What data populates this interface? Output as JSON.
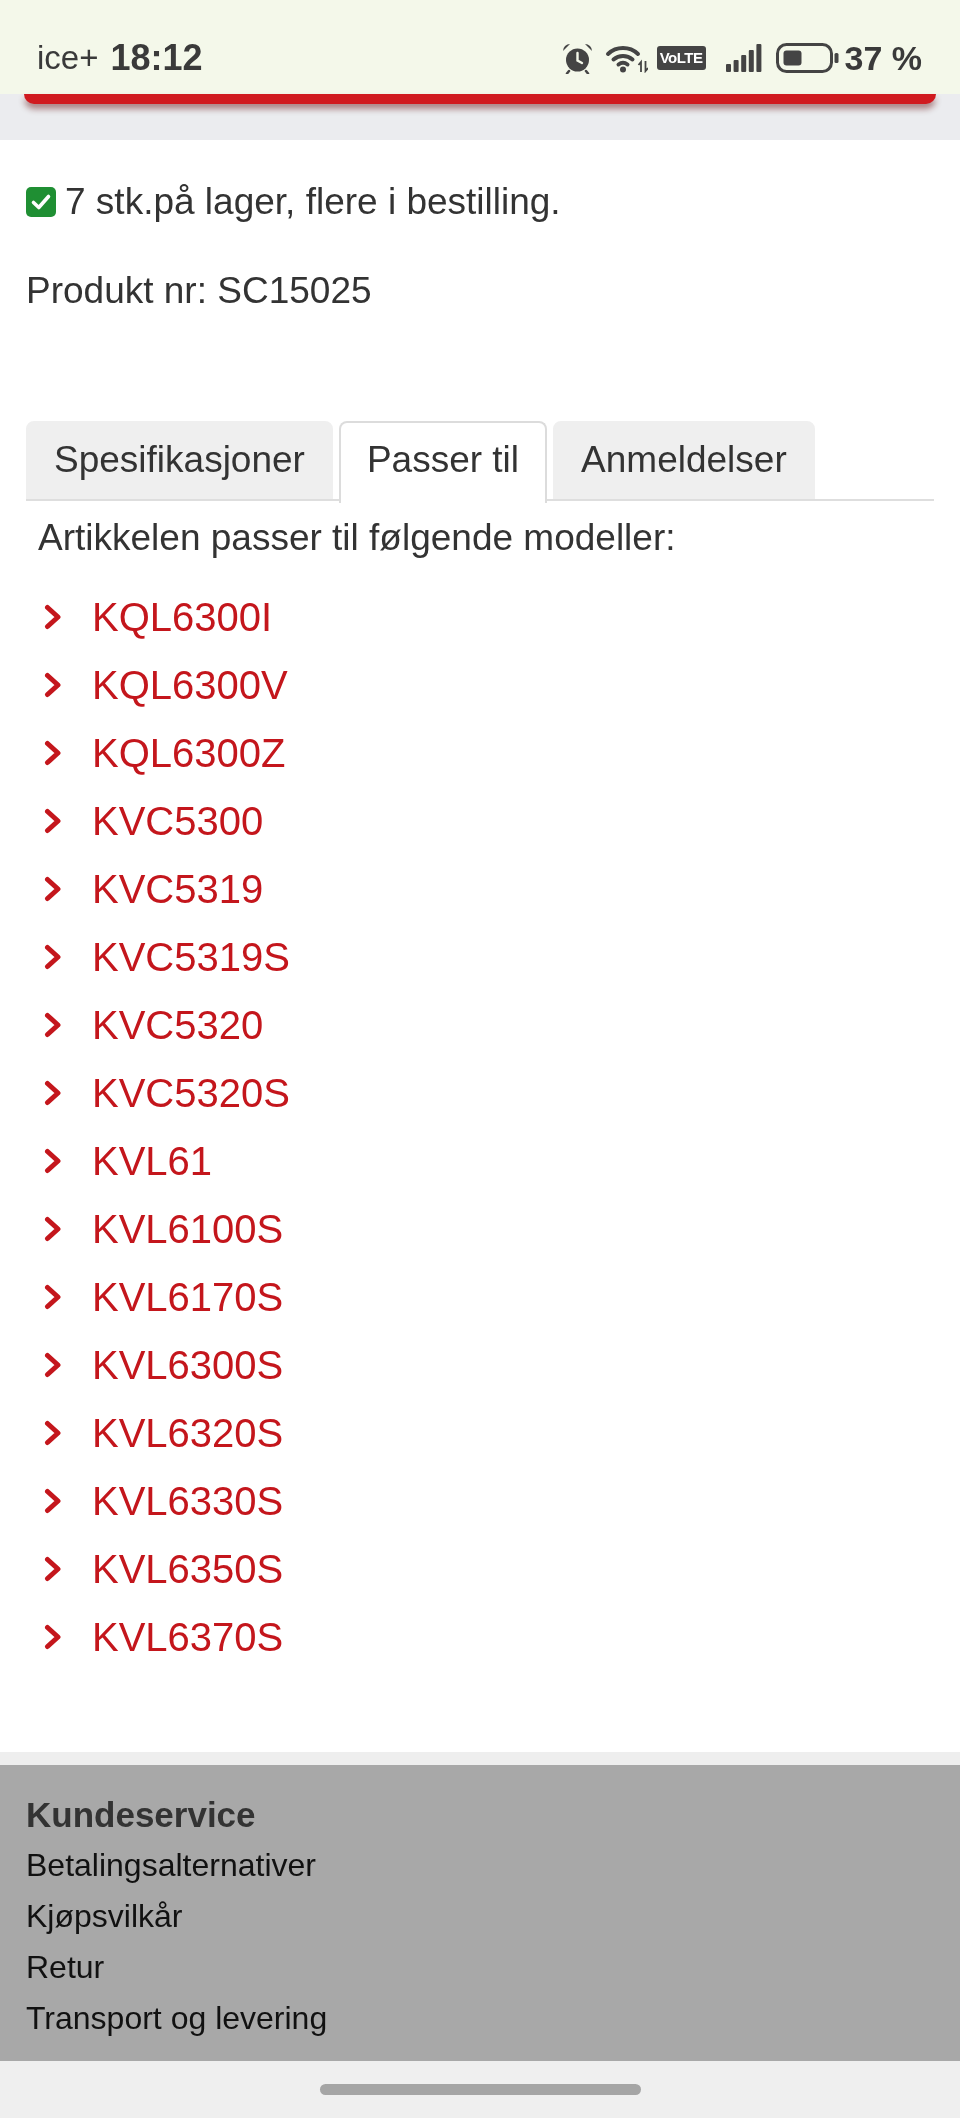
{
  "status_bar": {
    "carrier": "ice+",
    "time": "18:12",
    "network_badge": "VoLTE",
    "battery": "37 %"
  },
  "stock": {
    "available": true,
    "text": "7 stk.på lager, flere i bestilling."
  },
  "product_number": "Produkt nr: SC15025",
  "tabs": [
    {
      "label": "Spesifikasjoner",
      "selected": false
    },
    {
      "label": "Passer til",
      "selected": true
    },
    {
      "label": "Anmeldelser",
      "selected": false
    }
  ],
  "fits": {
    "intro": "Artikkelen passer til følgende modeller:",
    "models": [
      "KQL6300I",
      "KQL6300V",
      "KQL6300Z",
      "KVC5300",
      "KVC5319",
      "KVC5319S",
      "KVC5320",
      "KVC5320S",
      "KVL61",
      "KVL6100S",
      "KVL6170S",
      "KVL6300S",
      "KVL6320S",
      "KVL6330S",
      "KVL6350S",
      "KVL6370S"
    ]
  },
  "footer": {
    "heading": "Kundeservice",
    "links": [
      "Betalingsalternativer",
      "Kjøpsvilkår",
      "Retur",
      "Transport og levering"
    ]
  }
}
